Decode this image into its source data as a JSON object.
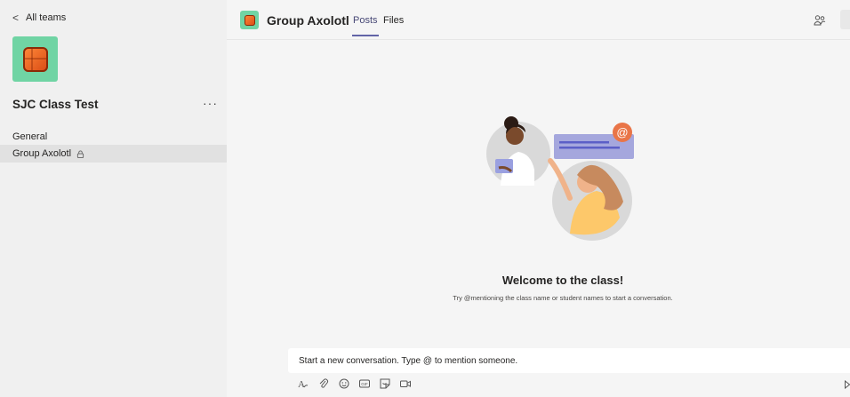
{
  "sidebar": {
    "back_label": "All teams",
    "team_name": "SJC Class Test",
    "more_label": "···",
    "channels": [
      {
        "label": "General"
      },
      {
        "label": "Group Axolotl"
      }
    ]
  },
  "header": {
    "title": "Group Axolotl",
    "tabs": [
      {
        "label": "Posts"
      },
      {
        "label": "Files"
      }
    ]
  },
  "main": {
    "welcome_title": "Welcome to the class!",
    "welcome_hint": "Try @mentioning the class name or student names to start a conversation.",
    "compose_placeholder": "Start a new conversation. Type @ to mention someone."
  },
  "icons": [
    "chevron-left-icon",
    "lock-icon",
    "people-icon",
    "format-icon",
    "attach-icon",
    "emoji-icon",
    "gif-icon",
    "sticker-icon",
    "meet-icon"
  ],
  "colors": {
    "accent": "#6264a7",
    "team_tile": "#70d4a4",
    "mention": "#e97548"
  }
}
